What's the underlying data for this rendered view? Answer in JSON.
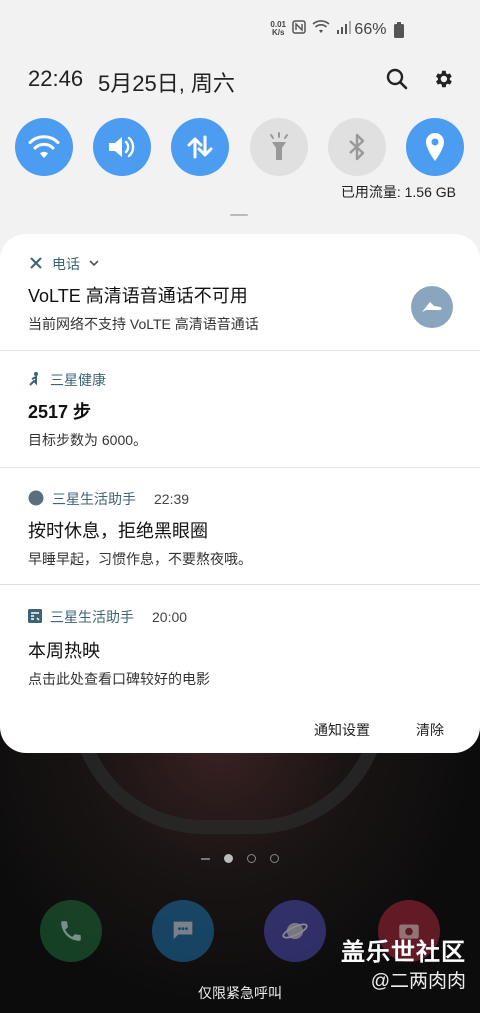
{
  "status_bar": {
    "speed_value": "0.01",
    "speed_unit": "K/s",
    "battery_percent": "66%"
  },
  "header": {
    "time": "22:46",
    "date": "5月25日, 周六"
  },
  "quick_toggles": [
    {
      "name": "wifi",
      "state": "on"
    },
    {
      "name": "sound",
      "state": "on"
    },
    {
      "name": "mobile-data",
      "state": "on"
    },
    {
      "name": "flashlight",
      "state": "off"
    },
    {
      "name": "bluetooth",
      "state": "off"
    },
    {
      "name": "location",
      "state": "on"
    }
  ],
  "data_usage": "已用流量: 1.56 GB",
  "notifications": [
    {
      "app": "电话",
      "title": "VoLTE 高清语音通话不可用",
      "text": "当前网络不支持 VoLTE 高清语音通话"
    },
    {
      "app": "三星健康",
      "title": "2517 步",
      "text": "目标步数为 6000。"
    },
    {
      "app": "三星生活助手",
      "time": "22:39",
      "title": "按时休息，拒绝黑眼圈",
      "text": "早睡早起，习惯作息，不要熬夜哦。"
    },
    {
      "app": "三星生活助手",
      "time": "20:00",
      "title": "本周热映",
      "text": "点击此处查看口碑较好的电影"
    }
  ],
  "actions": {
    "settings": "通知设置",
    "clear": "清除"
  },
  "lockscreen": {
    "emergency": "仅限紧急呼叫"
  },
  "watermark": {
    "site": "盖乐世社区",
    "user": "@二两肉肉"
  },
  "colors": {
    "accent": "#4c9df2",
    "panel_bg": "#f2f2f2",
    "app_label": "#3c6474"
  }
}
